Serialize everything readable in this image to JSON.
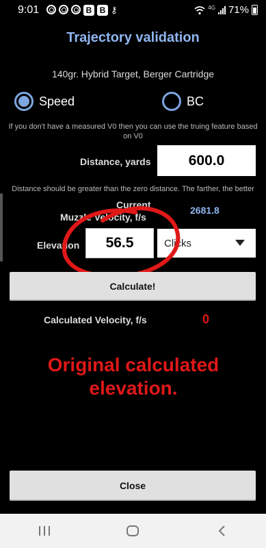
{
  "status_bar": {
    "time": "9:01",
    "network": "4G",
    "battery_text": "71%",
    "battery_level_percent": 71
  },
  "title": "Trajectory validation",
  "subtitle": "140gr. Hybrid Target, Berger Cartridge",
  "radios": {
    "speed_label": "Speed",
    "bc_label": "BC",
    "selected": "Speed"
  },
  "hint_v0": "If you don't have a measured V0 then you can use the truing feature based on V0",
  "distance": {
    "label": "Distance, yards",
    "value": "600.0"
  },
  "hint_distance": "Distance should be greater than the zero distance. The farther, the better",
  "muzzle_velocity": {
    "label_line1": "Current",
    "label_line2": "Muzzle Velocity, f/s",
    "value": "2681.8"
  },
  "elevation": {
    "label": "Elevation",
    "value": "56.5",
    "unit_selected": "Clicks"
  },
  "calculate_button": "Calculate!",
  "calculated_velocity": {
    "label": "Calculated Velocity, f/s",
    "value": "0"
  },
  "annotation": "Original calculated elevation.",
  "close_button": "Close",
  "colors": {
    "accent_blue": "#8fb6f0",
    "annotation_red": "#e01818",
    "background": "#000000"
  },
  "nav": {
    "recent_icon": "recent-apps-icon",
    "home_icon": "home-icon",
    "back_icon": "back-icon"
  }
}
